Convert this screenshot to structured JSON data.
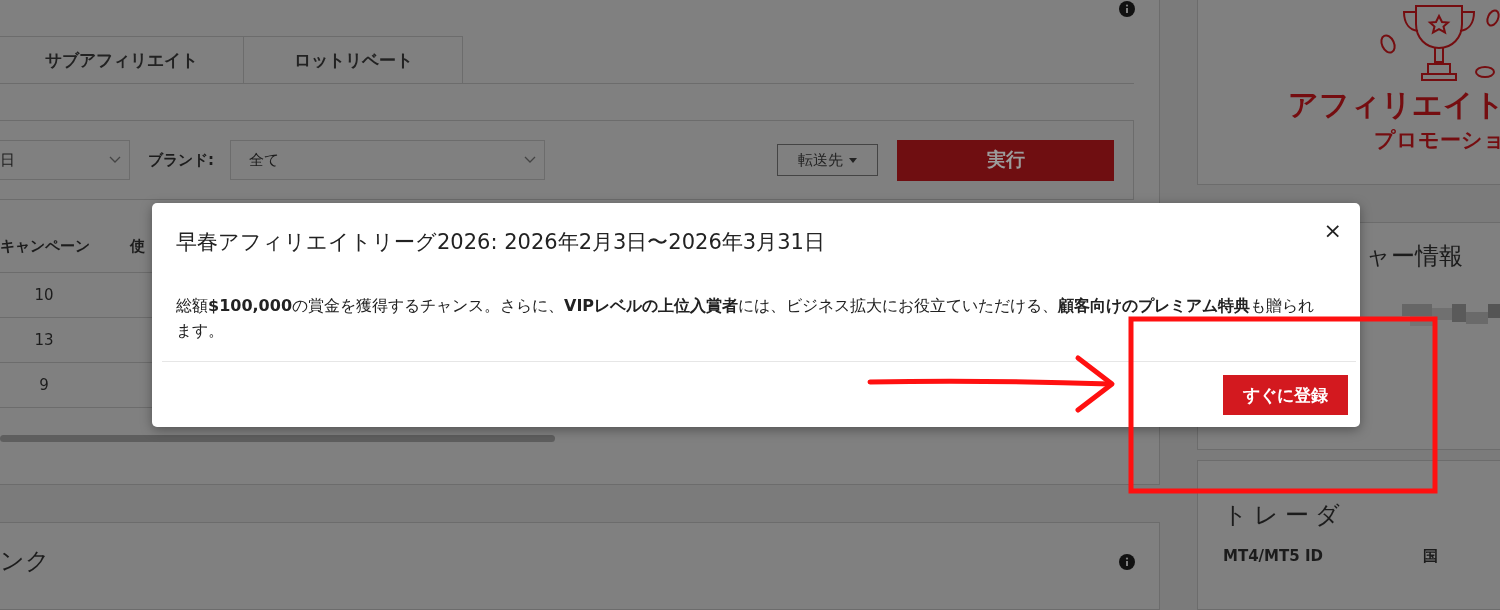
{
  "page": {
    "affiliate_panel": {
      "tabs": [
        {
          "label": "サブアフィリエイト",
          "selected": false
        },
        {
          "label": "ロットリベート",
          "selected": false
        }
      ],
      "filters": {
        "period": {
          "value": "日"
        },
        "brand_label": "ブランド:",
        "brand": {
          "value": "全て"
        },
        "transfer_button": "転送先",
        "run_button": "実行"
      },
      "table": {
        "columns": [
          "キャンペーン",
          "使"
        ],
        "rows": [
          [
            "10"
          ],
          [
            "13"
          ],
          [
            "9"
          ]
        ]
      }
    },
    "links_panel": {
      "title": "ンク"
    },
    "promo_card": {
      "title_line_1": "アフィリエイト",
      "title_line_2": "プロモーショ"
    },
    "manager_card": {
      "title": "ャー情報"
    },
    "trader_card": {
      "title": "トレーダ",
      "columns": [
        "MT4/MT5 ID",
        "国"
      ]
    }
  },
  "dialog": {
    "title": "早春アフィリエイトリーグ2026: 2026年2月3日〜2026年3月31日",
    "close": "×",
    "body": "総額**$100,000**の賞金を獲得するチャンス。さらに、**VIPレベルの上位入賞者**には、ビジネス拡大にお役立ていただける、**顧客向けのプレミアム特典**も贈られます。",
    "button": "すぐに登録"
  }
}
